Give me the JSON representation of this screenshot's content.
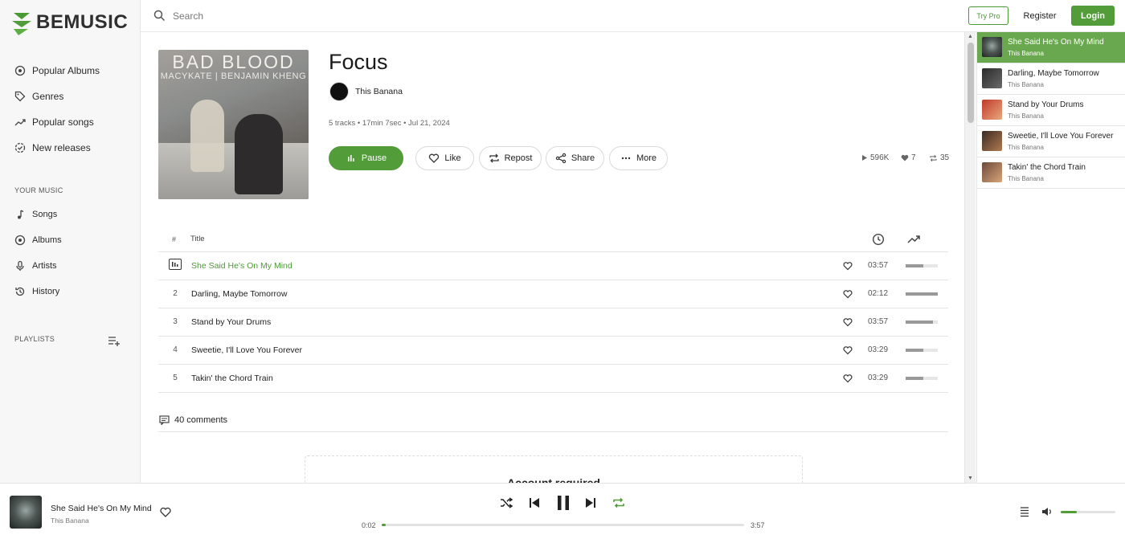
{
  "brand": {
    "name": "BEMUSIC",
    "color": "#529c3a"
  },
  "sidebar": {
    "nav": [
      {
        "label": "Popular Albums",
        "icon": "album-icon"
      },
      {
        "label": "Genres",
        "icon": "tag-icon"
      },
      {
        "label": "Popular songs",
        "icon": "trending-icon"
      },
      {
        "label": "New releases",
        "icon": "new-releases-icon"
      }
    ],
    "your_music_label": "YOUR MUSIC",
    "your_music": [
      {
        "label": "Songs",
        "icon": "music-note-icon"
      },
      {
        "label": "Albums",
        "icon": "album-icon"
      },
      {
        "label": "Artists",
        "icon": "microphone-icon"
      },
      {
        "label": "History",
        "icon": "history-icon"
      }
    ],
    "playlists_label": "PLAYLISTS"
  },
  "topbar": {
    "search_placeholder": "Search",
    "try_pro": "Try Pro",
    "register": "Register",
    "login": "Login"
  },
  "album": {
    "title": "Focus",
    "artist": "This Banana",
    "meta": "5 tracks • 17min 7sec • Jul 21, 2024",
    "cover_title": "BAD BLOOD",
    "cover_subtitle": "MACYKATE | BENJAMIN KHENG",
    "actions": {
      "pause": "Pause",
      "like": "Like",
      "repost": "Repost",
      "share": "Share",
      "more": "More"
    },
    "stats": {
      "plays": "596K",
      "likes": "7",
      "reposts": "35"
    }
  },
  "track_table": {
    "headers": {
      "num": "#",
      "title": "Title"
    },
    "tracks": [
      {
        "num": "1",
        "title": "She Said He's On My Mind",
        "duration": "03:57",
        "popularity": 0.55,
        "playing": true
      },
      {
        "num": "2",
        "title": "Darling, Maybe Tomorrow",
        "duration": "02:12",
        "popularity": 1.0,
        "playing": false
      },
      {
        "num": "3",
        "title": "Stand by Your Drums",
        "duration": "03:57",
        "popularity": 0.85,
        "playing": false
      },
      {
        "num": "4",
        "title": "Sweetie, I'll Love You Forever",
        "duration": "03:29",
        "popularity": 0.55,
        "playing": false
      },
      {
        "num": "5",
        "title": "Takin' the Chord Train",
        "duration": "03:29",
        "popularity": 0.55,
        "playing": false
      }
    ]
  },
  "comments": {
    "label": "40 comments",
    "account_required": "Account required"
  },
  "queue": [
    {
      "title": "She Said He's On My Mind",
      "artist": "This Banana",
      "active": true
    },
    {
      "title": "Darling, Maybe Tomorrow",
      "artist": "This Banana",
      "active": false
    },
    {
      "title": "Stand by Your Drums",
      "artist": "This Banana",
      "active": false
    },
    {
      "title": "Sweetie, I'll Love You Forever",
      "artist": "This Banana",
      "active": false
    },
    {
      "title": "Takin' the Chord Train",
      "artist": "This Banana",
      "active": false
    }
  ],
  "player": {
    "title": "She Said He's On My Mind",
    "artist": "This Banana",
    "current_time": "0:02",
    "total_time": "3:57",
    "progress": 0.01,
    "volume": 0.3
  }
}
